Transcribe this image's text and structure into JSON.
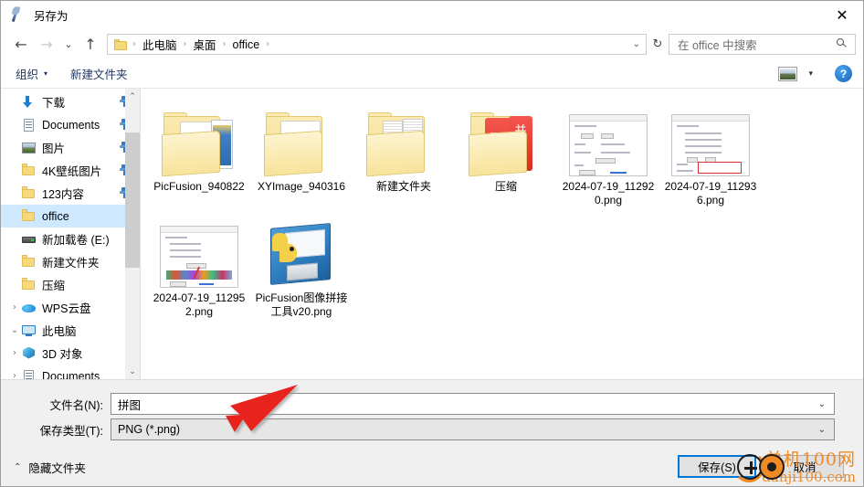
{
  "window": {
    "title": "另存为",
    "title_icon": "quill-icon",
    "close_label": "✕"
  },
  "nav": {
    "back_icon": "←",
    "forward_icon": "→",
    "recent_icon": "⌄",
    "up_icon": "↑",
    "refresh_icon": "↻",
    "addr_chevron": "⌄",
    "breadcrumbs": [
      "此电脑",
      "桌面",
      "office"
    ],
    "separator": "›"
  },
  "search": {
    "placeholder": "在 office 中搜索",
    "icon": "search-icon"
  },
  "toolbar": {
    "organize_label": "组织",
    "organize_caret": "▾",
    "new_folder_label": "新建文件夹",
    "view_caret": "▾",
    "help_label": "?"
  },
  "sidebar": {
    "items": [
      {
        "label": "下载",
        "icon": "download-icon",
        "twisty": "",
        "pinned": true,
        "selected": false
      },
      {
        "label": "Documents",
        "icon": "document-icon",
        "twisty": "",
        "pinned": true,
        "selected": false
      },
      {
        "label": "图片",
        "icon": "pictures-icon",
        "twisty": "",
        "pinned": true,
        "selected": false
      },
      {
        "label": "4K壁纸图片",
        "icon": "folder-icon",
        "twisty": "",
        "pinned": true,
        "selected": false
      },
      {
        "label": "123内容",
        "icon": "folder-icon",
        "twisty": "",
        "pinned": true,
        "selected": false
      },
      {
        "label": "office",
        "icon": "folder-icon",
        "twisty": "",
        "pinned": false,
        "selected": true
      },
      {
        "label": "新加载卷 (E:)",
        "icon": "drive-icon",
        "twisty": "",
        "pinned": false,
        "selected": false
      },
      {
        "label": "新建文件夹",
        "icon": "folder-icon",
        "twisty": "",
        "pinned": false,
        "selected": false
      },
      {
        "label": "压缩",
        "icon": "folder-icon",
        "twisty": "",
        "pinned": false,
        "selected": false
      },
      {
        "label": "WPS云盘",
        "icon": "cloud-icon",
        "twisty": "›",
        "pinned": false,
        "selected": false
      },
      {
        "label": "此电脑",
        "icon": "pc-icon",
        "twisty": "⌄",
        "pinned": false,
        "selected": false
      },
      {
        "label": "3D 对象",
        "icon": "cube-icon",
        "twisty": "›",
        "pinned": false,
        "selected": false
      },
      {
        "label": "Documents",
        "icon": "document-icon",
        "twisty": "›",
        "pinned": false,
        "selected": false
      }
    ],
    "scroll_up": "⌃",
    "scroll_down": "⌄"
  },
  "files": [
    {
      "name": "PicFusion_940822",
      "kind": "folder-gear-picture"
    },
    {
      "name": "XYImage_940316",
      "kind": "folder-gear"
    },
    {
      "name": "新建文件夹",
      "kind": "folder-documents"
    },
    {
      "name": "压缩",
      "kind": "folder-red-archive"
    },
    {
      "name": "2024-07-19_112920.png",
      "kind": "screenshot-1"
    },
    {
      "name": "2024-07-19_112936.png",
      "kind": "screenshot-2"
    },
    {
      "name": "2024-07-19_112952.png",
      "kind": "screenshot-3"
    },
    {
      "name": "PicFusion图像拼接工具v20.png",
      "kind": "floppy-python"
    }
  ],
  "form": {
    "filename_label": "文件名(N):",
    "filename_value": "拼图",
    "filetype_label": "保存类型(T):",
    "filetype_value": "PNG (*.png)",
    "chevron": "⌄"
  },
  "footer": {
    "hide_folders_label": "隐藏文件夹",
    "hide_folders_caret": "⌃",
    "save_label": "保存(S)",
    "cancel_label": "取消"
  },
  "watermark": {
    "line1": "单机100网",
    "line2": "danji100.com",
    "color": "#f08a24"
  },
  "colors": {
    "accent": "#0078d7",
    "selection": "#cde8ff",
    "toolbar_text": "#1f3864",
    "annotation_red": "#e8221c"
  }
}
